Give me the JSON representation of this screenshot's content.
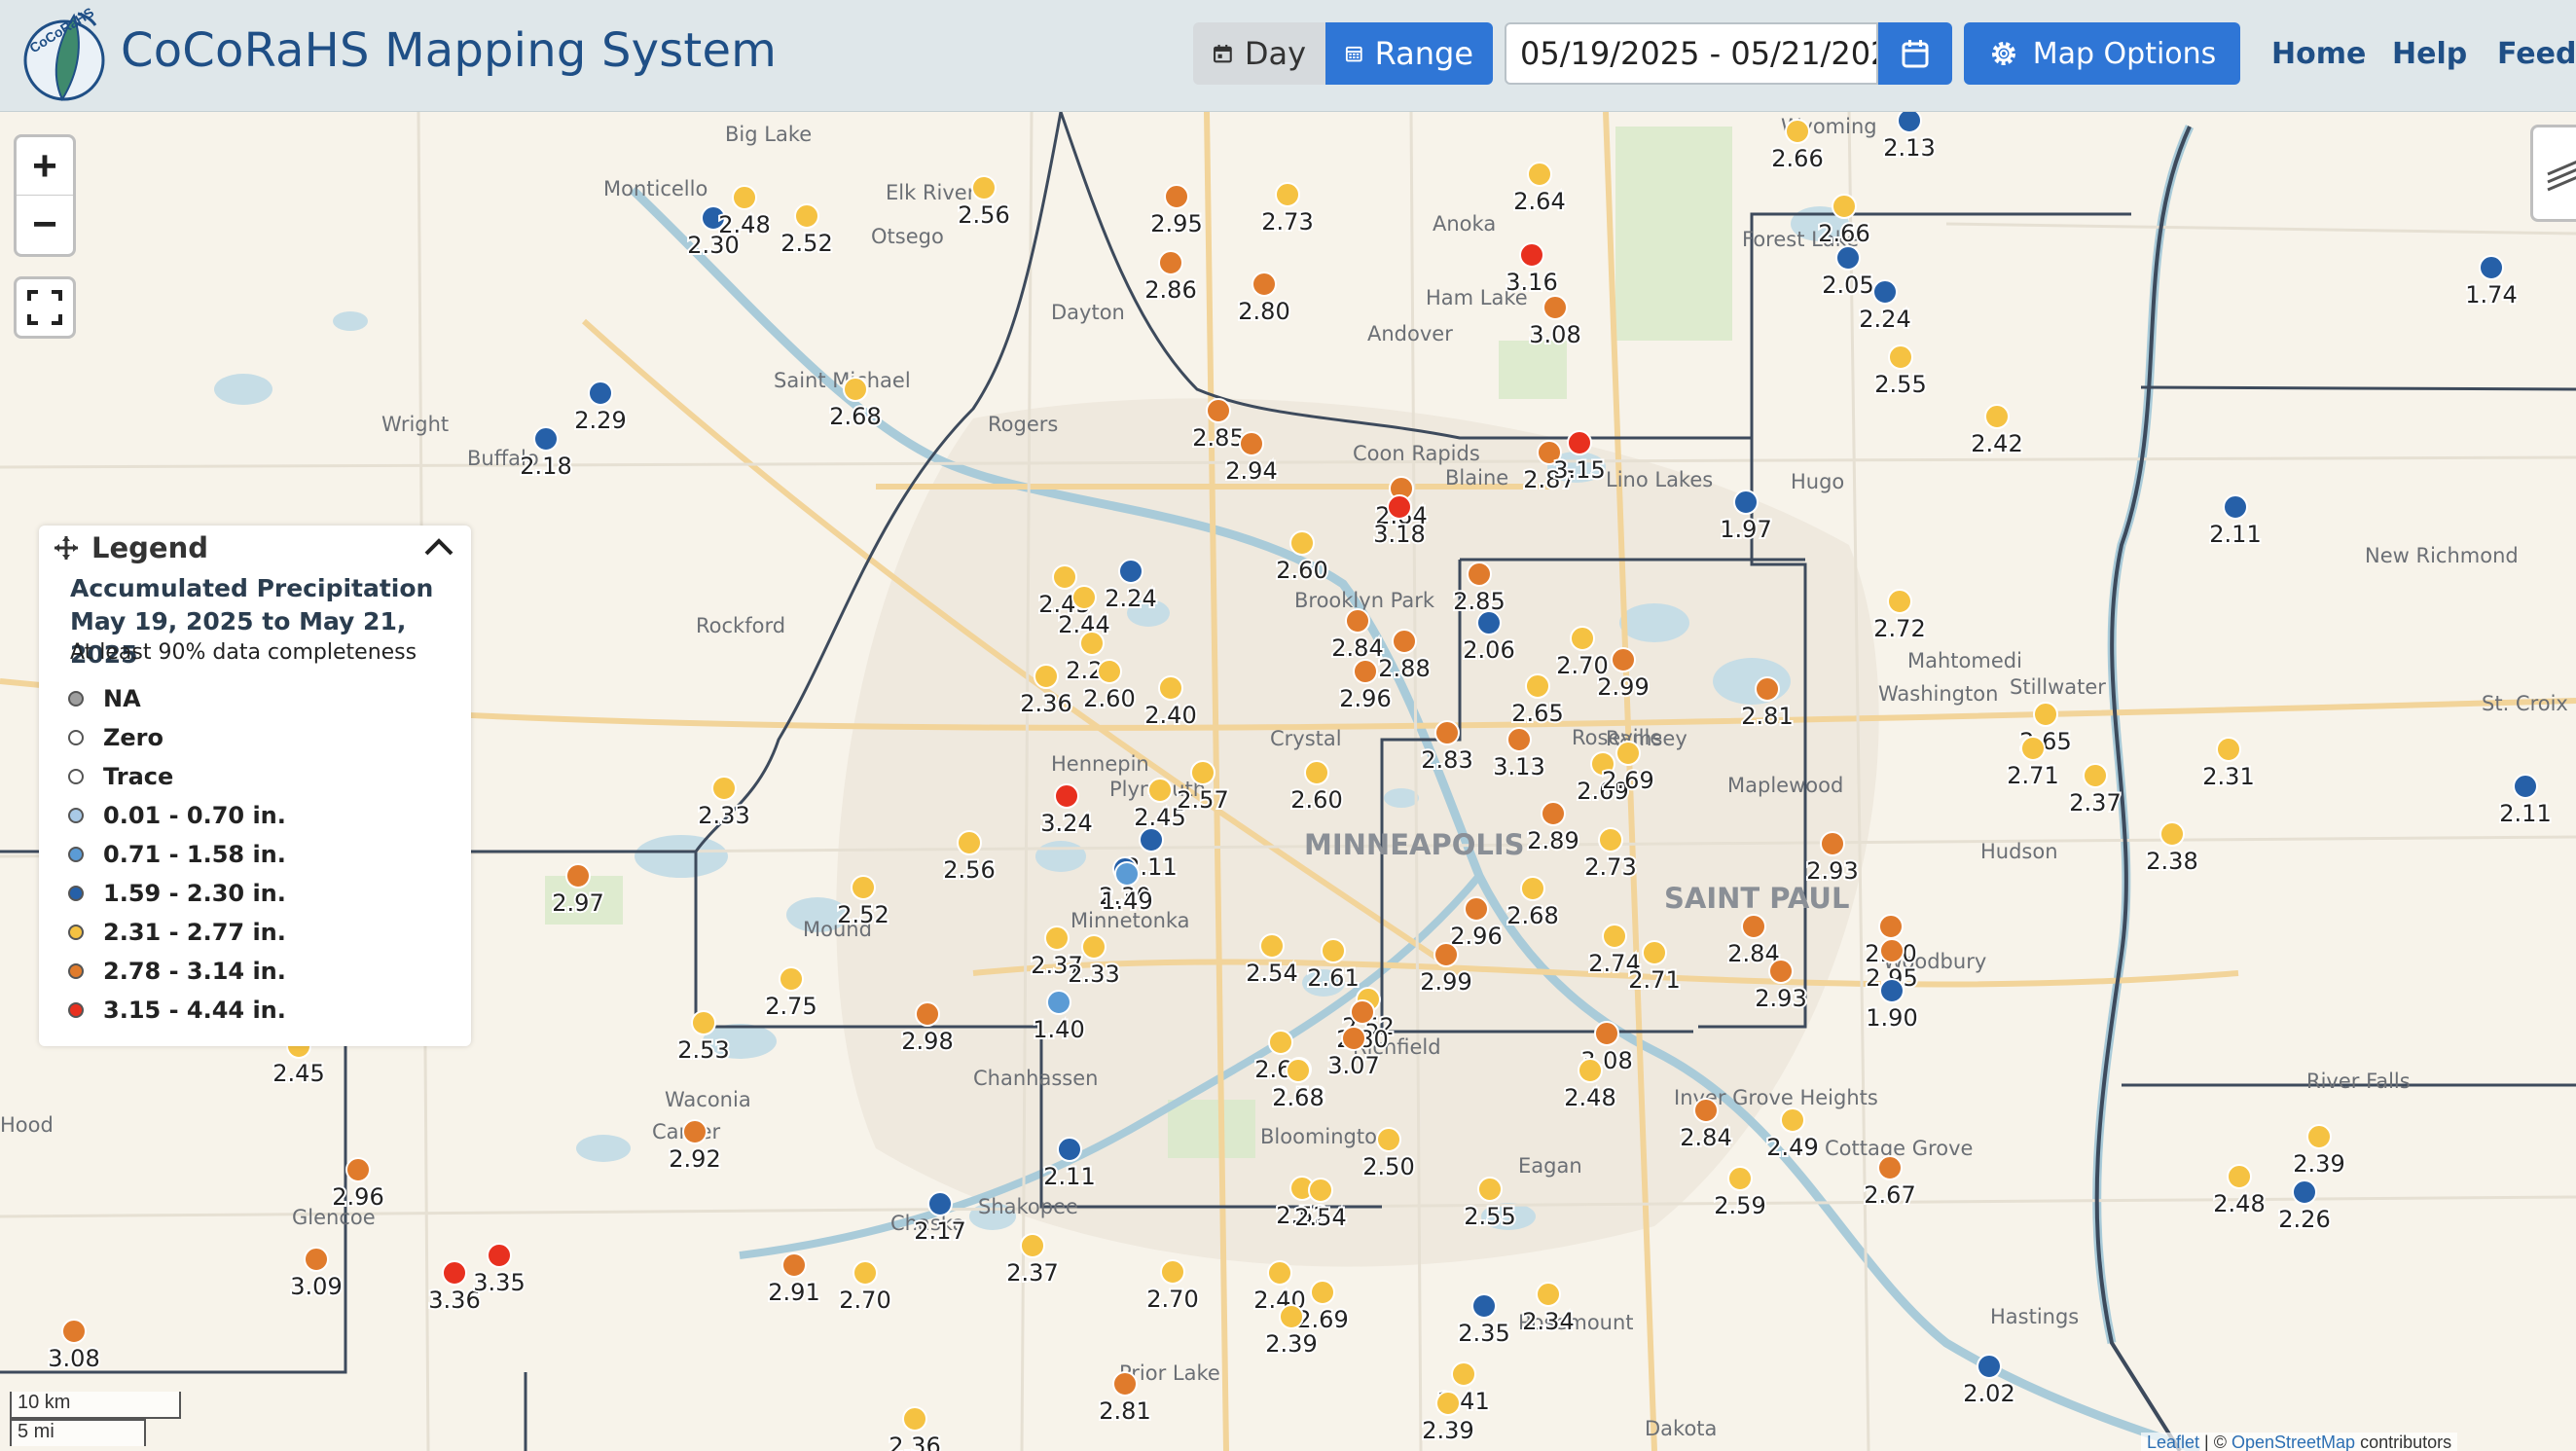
{
  "app": {
    "title": "CoCoRaHS Mapping System",
    "logo_text": "CoCoRaHS"
  },
  "header": {
    "day_label": "Day",
    "range_label": "Range",
    "date_range_value": "05/19/2025 - 05/21/2025",
    "map_options_label": "Map Options",
    "nav": [
      "Home",
      "Help",
      "Feedb"
    ]
  },
  "legend": {
    "heading": "Legend",
    "title_line1": "Accumulated Precipitation",
    "title_line2": "May 19, 2025 to May 21, 2025",
    "subtitle": "At least 90% data completeness",
    "items": [
      {
        "label": "NA",
        "color": "#9e9e9e"
      },
      {
        "label": "Zero",
        "color": "#ffffff"
      },
      {
        "label": "Trace",
        "color": "#ffffff"
      },
      {
        "label": "0.01 - 0.70 in.",
        "color": "#a9c9e6"
      },
      {
        "label": "0.71 - 1.58 in.",
        "color": "#5b9bd5"
      },
      {
        "label": "1.59 - 2.30 in.",
        "color": "#2660a8"
      },
      {
        "label": "2.31 - 2.77 in.",
        "color": "#f5c242"
      },
      {
        "label": "2.78 - 3.14 in.",
        "color": "#e07b2c"
      },
      {
        "label": "3.15 - 4.44 in.",
        "color": "#e8301f"
      }
    ]
  },
  "map": {
    "places": [
      {
        "name": "Big Lake"
      },
      {
        "name": "Monticello"
      },
      {
        "name": "Elk River"
      },
      {
        "name": "Otsego"
      },
      {
        "name": "Anoka"
      },
      {
        "name": "Ham Lake"
      },
      {
        "name": "Andover"
      },
      {
        "name": "Dayton"
      },
      {
        "name": "Wright"
      },
      {
        "name": "Saint Michael"
      },
      {
        "name": "Rogers"
      },
      {
        "name": "Coon Rapids"
      },
      {
        "name": "Blaine"
      },
      {
        "name": "Lino Lakes"
      },
      {
        "name": "Hugo"
      },
      {
        "name": "Forest Lake"
      },
      {
        "name": "Wyoming"
      },
      {
        "name": "New Richmond"
      },
      {
        "name": "Brooklyn Park"
      },
      {
        "name": "Rockford"
      },
      {
        "name": "Crystal"
      },
      {
        "name": "Hennepin"
      },
      {
        "name": "Plymouth"
      },
      {
        "name": "MINNEAPOLIS"
      },
      {
        "name": "Roseville"
      },
      {
        "name": "Ramsey"
      },
      {
        "name": "Maplewood"
      },
      {
        "name": "Mahtomedi"
      },
      {
        "name": "Washington"
      },
      {
        "name": "Stillwater"
      },
      {
        "name": "Hudson"
      },
      {
        "name": "St. Croix"
      },
      {
        "name": "SAINT PAUL"
      },
      {
        "name": "Minnetonka"
      },
      {
        "name": "Mound"
      },
      {
        "name": "Woodbury"
      },
      {
        "name": "Chanhassen"
      },
      {
        "name": "Waconia"
      },
      {
        "name": "Carver"
      },
      {
        "name": "Bloomington"
      },
      {
        "name": "Eagan"
      },
      {
        "name": "Inver Grove Heights"
      },
      {
        "name": "Cottage Grove"
      },
      {
        "name": "River Falls"
      },
      {
        "name": "Shakopee"
      },
      {
        "name": "Chaska"
      },
      {
        "name": "Glencoe"
      },
      {
        "name": "Prior Lake"
      },
      {
        "name": "Rosemount"
      },
      {
        "name": "Hastings"
      },
      {
        "name": "Dakota"
      },
      {
        "name": "Richfield"
      },
      {
        "name": "Buffalo"
      },
      {
        "name": "Hood"
      }
    ],
    "stations": [
      {
        "v": "2.30",
        "c": "#2660a8"
      },
      {
        "v": "2.48",
        "c": "#f5c242"
      },
      {
        "v": "2.52",
        "c": "#f5c242"
      },
      {
        "v": "2.56",
        "c": "#f5c242"
      },
      {
        "v": "2.95",
        "c": "#e07b2c"
      },
      {
        "v": "2.73",
        "c": "#f5c242"
      },
      {
        "v": "2.86",
        "c": "#e07b2c"
      },
      {
        "v": "2.80",
        "c": "#e07b2c"
      },
      {
        "v": "2.64",
        "c": "#f5c242"
      },
      {
        "v": "3.16",
        "c": "#e8301f"
      },
      {
        "v": "3.08",
        "c": "#e07b2c"
      },
      {
        "v": "2.66",
        "c": "#f5c242"
      },
      {
        "v": "2.13",
        "c": "#2660a8"
      },
      {
        "v": "2.66",
        "c": "#f5c242"
      },
      {
        "v": "2.05",
        "c": "#2660a8"
      },
      {
        "v": "2.24",
        "c": "#2660a8"
      },
      {
        "v": "2.55",
        "c": "#f5c242"
      },
      {
        "v": "1.74",
        "c": "#2660a8"
      },
      {
        "v": "2.29",
        "c": "#2660a8"
      },
      {
        "v": "2.18",
        "c": "#2660a8"
      },
      {
        "v": "2.68",
        "c": "#f5c242"
      },
      {
        "v": "2.85",
        "c": "#e07b2c"
      },
      {
        "v": "2.94",
        "c": "#e07b2c"
      },
      {
        "v": "2.87",
        "c": "#e07b2c"
      },
      {
        "v": "3.15",
        "c": "#e8301f"
      },
      {
        "v": "2.42",
        "c": "#f5c242"
      },
      {
        "v": "2.84",
        "c": "#e07b2c"
      },
      {
        "v": "3.18",
        "c": "#e8301f"
      },
      {
        "v": "1.97",
        "c": "#2660a8"
      },
      {
        "v": "2.11",
        "c": "#2660a8"
      },
      {
        "v": "2.45",
        "c": "#f5c242"
      },
      {
        "v": "2.24",
        "c": "#2660a8"
      },
      {
        "v": "2.44",
        "c": "#f5c242"
      },
      {
        "v": "2.60",
        "c": "#f5c242"
      },
      {
        "v": "2.85",
        "c": "#e07b2c"
      },
      {
        "v": "2.06",
        "c": "#2660a8"
      },
      {
        "v": "2.72",
        "c": "#f5c242"
      },
      {
        "v": "2.36",
        "c": "#f5c242"
      },
      {
        "v": "2.22",
        "c": "#f5c242"
      },
      {
        "v": "2.60",
        "c": "#f5c242"
      },
      {
        "v": "2.40",
        "c": "#f5c242"
      },
      {
        "v": "2.84",
        "c": "#e07b2c"
      },
      {
        "v": "2.88",
        "c": "#e07b2c"
      },
      {
        "v": "2.96",
        "c": "#e07b2c"
      },
      {
        "v": "2.70",
        "c": "#f5c242"
      },
      {
        "v": "2.99",
        "c": "#e07b2c"
      },
      {
        "v": "2.65",
        "c": "#f5c242"
      },
      {
        "v": "2.81",
        "c": "#e07b2c"
      },
      {
        "v": "2.65",
        "c": "#f5c242"
      },
      {
        "v": "2.71",
        "c": "#f5c242"
      },
      {
        "v": "2.37",
        "c": "#f5c242"
      },
      {
        "v": "2.31",
        "c": "#f5c242"
      },
      {
        "v": "2.33",
        "c": "#f5c242"
      },
      {
        "v": "3.24",
        "c": "#e8301f"
      },
      {
        "v": "2.45",
        "c": "#f5c242"
      },
      {
        "v": "2.57",
        "c": "#f5c242"
      },
      {
        "v": "2.60",
        "c": "#f5c242"
      },
      {
        "v": "2.83",
        "c": "#e07b2c"
      },
      {
        "v": "3.13",
        "c": "#e07b2c"
      },
      {
        "v": "2.69",
        "c": "#f5c242"
      },
      {
        "v": "2.69",
        "c": "#f5c242"
      },
      {
        "v": "2.11",
        "c": "#2660a8"
      },
      {
        "v": "2.97",
        "c": "#e07b2c"
      },
      {
        "v": "2.56",
        "c": "#f5c242"
      },
      {
        "v": "2.30",
        "c": "#2660a8"
      },
      {
        "v": "1.49",
        "c": "#5b9bd5"
      },
      {
        "v": "2.89",
        "c": "#e07b2c"
      },
      {
        "v": "2.73",
        "c": "#f5c242"
      },
      {
        "v": "2.93",
        "c": "#e07b2c"
      },
      {
        "v": "2.38",
        "c": "#f5c242"
      },
      {
        "v": "2.52",
        "c": "#f5c242"
      },
      {
        "v": "2.96",
        "c": "#e07b2c"
      },
      {
        "v": "2.68",
        "c": "#f5c242"
      },
      {
        "v": "2.84",
        "c": "#e07b2c"
      },
      {
        "v": "2.90",
        "c": "#e07b2c"
      },
      {
        "v": "2.95",
        "c": "#e07b2c"
      },
      {
        "v": "2.37",
        "c": "#f5c242"
      },
      {
        "v": "2.33",
        "c": "#f5c242"
      },
      {
        "v": "2.54",
        "c": "#f5c242"
      },
      {
        "v": "2.61",
        "c": "#f5c242"
      },
      {
        "v": "2.99",
        "c": "#e07b2c"
      },
      {
        "v": "2.74",
        "c": "#f5c242"
      },
      {
        "v": "2.71",
        "c": "#f5c242"
      },
      {
        "v": "2.93",
        "c": "#e07b2c"
      },
      {
        "v": "1.90",
        "c": "#2660a8"
      },
      {
        "v": "2.75",
        "c": "#f5c242"
      },
      {
        "v": "1.40",
        "c": "#5b9bd5"
      },
      {
        "v": "2.52",
        "c": "#f5c242"
      },
      {
        "v": "2.80",
        "c": "#e07b2c"
      },
      {
        "v": "2.53",
        "c": "#f5c242"
      },
      {
        "v": "2.98",
        "c": "#e07b2c"
      },
      {
        "v": "2.45",
        "c": "#f5c242"
      },
      {
        "v": "3.08",
        "c": "#e07b2c"
      },
      {
        "v": "2.63",
        "c": "#f5c242"
      },
      {
        "v": "2.58",
        "c": "#f5c242"
      },
      {
        "v": "3.07",
        "c": "#e07b2c"
      },
      {
        "v": "2.48",
        "c": "#f5c242"
      },
      {
        "v": "2.68",
        "c": "#f5c242"
      },
      {
        "v": "2.84",
        "c": "#e07b2c"
      },
      {
        "v": "2.49",
        "c": "#f5c242"
      },
      {
        "v": "2.92",
        "c": "#e07b2c"
      },
      {
        "v": "2.11",
        "c": "#2660a8"
      },
      {
        "v": "2.50",
        "c": "#f5c242"
      },
      {
        "v": "2.39",
        "c": "#f5c242"
      },
      {
        "v": "2.96",
        "c": "#e07b2c"
      },
      {
        "v": "2.52",
        "c": "#f5c242"
      },
      {
        "v": "2.54",
        "c": "#f5c242"
      },
      {
        "v": "2.55",
        "c": "#f5c242"
      },
      {
        "v": "2.59",
        "c": "#f5c242"
      },
      {
        "v": "2.67",
        "c": "#e07b2c"
      },
      {
        "v": "2.48",
        "c": "#f5c242"
      },
      {
        "v": "2.26",
        "c": "#2660a8"
      },
      {
        "v": "2.17",
        "c": "#2660a8"
      },
      {
        "v": "2.37",
        "c": "#f5c242"
      },
      {
        "v": "3.09",
        "c": "#e07b2c"
      },
      {
        "v": "3.36",
        "c": "#e8301f"
      },
      {
        "v": "3.35",
        "c": "#e8301f"
      },
      {
        "v": "2.91",
        "c": "#e07b2c"
      },
      {
        "v": "2.70",
        "c": "#f5c242"
      },
      {
        "v": "2.70",
        "c": "#f5c242"
      },
      {
        "v": "2.40",
        "c": "#f5c242"
      },
      {
        "v": "2.69",
        "c": "#f5c242"
      },
      {
        "v": "2.39",
        "c": "#f5c242"
      },
      {
        "v": "2.35",
        "c": "#2660a8"
      },
      {
        "v": "2.34",
        "c": "#f5c242"
      },
      {
        "v": "3.08",
        "c": "#e07b2c"
      },
      {
        "v": "2.81",
        "c": "#e07b2c"
      },
      {
        "v": "2.41",
        "c": "#f5c242"
      },
      {
        "v": "2.39",
        "c": "#f5c242"
      },
      {
        "v": "2.02",
        "c": "#2660a8"
      },
      {
        "v": "2.36",
        "c": "#f5c242"
      },
      {
        "v": "2.11",
        "c": "#2660a8"
      }
    ],
    "scale_metric": "10 km",
    "scale_imperial": "5 mi",
    "attribution_leaflet": "Leaflet",
    "attribution_osm": "OpenStreetMap",
    "attribution_tail": "contributors",
    "zoom_in_label": "+",
    "zoom_out_label": "−"
  }
}
